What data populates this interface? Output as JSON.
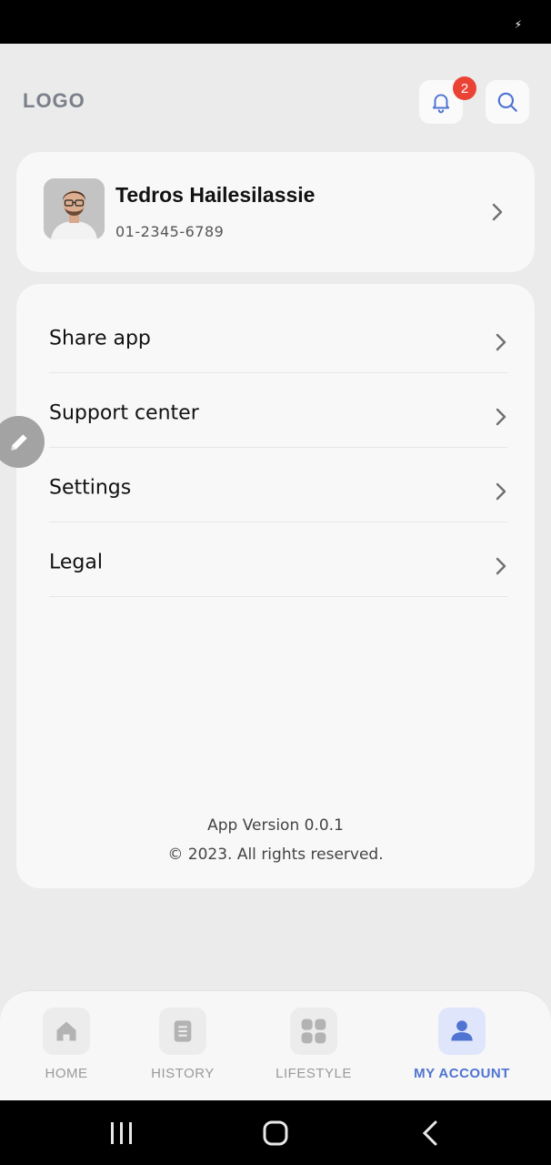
{
  "header": {
    "logo": "LOGO",
    "notifications": {
      "count": "2",
      "icon": "bell-icon"
    },
    "search": {
      "icon": "search-icon"
    }
  },
  "profile": {
    "name": "Tedros Hailesilassie",
    "phone": "01-2345-6789"
  },
  "menu": {
    "items": [
      {
        "label": "Share app"
      },
      {
        "label": "Support center"
      },
      {
        "label": "Settings"
      },
      {
        "label": "Legal"
      }
    ],
    "version": "App Version 0.0.1",
    "copyright": "© 2023. All rights reserved."
  },
  "nav": {
    "items": [
      {
        "label": "HOME",
        "icon": "home-icon"
      },
      {
        "label": "HISTORY",
        "icon": "history-icon"
      },
      {
        "label": "LIFESTYLE",
        "icon": "grid-icon"
      },
      {
        "label": "MY ACCOUNT",
        "icon": "user-icon"
      }
    ],
    "active_index": 3
  },
  "colors": {
    "accent": "#4f74d1",
    "badge": "#ea4335",
    "background": "#ebebeb",
    "card": "#f8f8f8"
  }
}
